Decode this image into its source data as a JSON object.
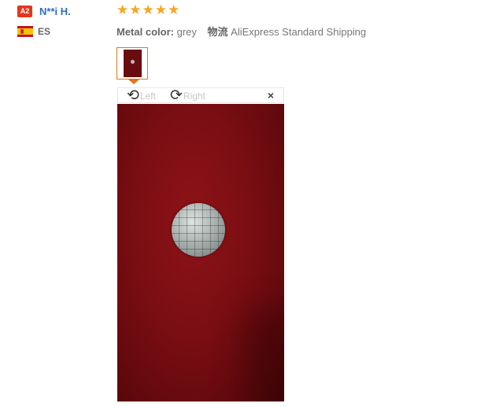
{
  "user": {
    "level_badge": "A2",
    "name": "N**i H.",
    "country_code": "ES",
    "flag_icon": "spain-flag-icon"
  },
  "review": {
    "rating": 5,
    "rating_max": 5,
    "star_symbol": "★",
    "star_color": "#f5a623",
    "attribute_label": "Metal color:",
    "attribute_value": "grey",
    "shipping_label": "物流",
    "shipping_value": "AliExpress Standard Shipping"
  },
  "viewer": {
    "rotate_left_icon": "⟲",
    "rotate_left_label": "Left",
    "rotate_right_icon": "⟳",
    "rotate_right_label": "Right",
    "close_symbol": "×"
  },
  "colors": {
    "accent": "#e0771d",
    "user_name": "#2e6ec0",
    "badge": "#e0381d"
  }
}
